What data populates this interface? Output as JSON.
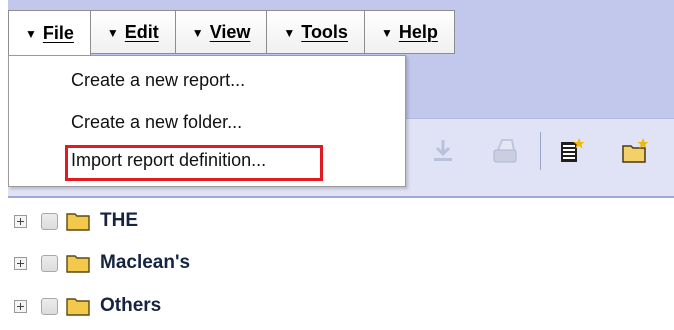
{
  "menubar": {
    "items": [
      {
        "label": "File",
        "arrow": "▼"
      },
      {
        "label": "Edit",
        "arrow": "▼"
      },
      {
        "label": "View",
        "arrow": "▼"
      },
      {
        "label": "Tools",
        "arrow": "▼"
      },
      {
        "label": "Help",
        "arrow": "▼"
      }
    ]
  },
  "file_menu": {
    "items": [
      {
        "label": "Create a new report..."
      },
      {
        "label": "Create a new folder..."
      },
      {
        "label": "Import report definition..."
      }
    ],
    "highlight_color": "#e21b23"
  },
  "toolbar": {
    "icons": [
      "download-icon",
      "print-icon",
      "new-report-icon",
      "new-folder-icon"
    ]
  },
  "tree": {
    "items": [
      {
        "label": "THE"
      },
      {
        "label": "Maclean's"
      },
      {
        "label": "Others"
      }
    ]
  },
  "colors": {
    "header_band": "#c2c8ec",
    "tree_text": "#16243f",
    "folder_fill": "#f2c94c"
  }
}
